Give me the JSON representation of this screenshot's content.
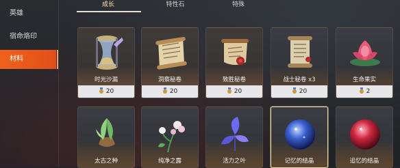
{
  "sidebar": {
    "items": [
      {
        "label": "英雄"
      },
      {
        "label": "宿命烙印"
      },
      {
        "label": "材料",
        "active": true
      }
    ]
  },
  "tabs": [
    {
      "label": "成长",
      "active": true
    },
    {
      "label": "特性石"
    },
    {
      "label": "特殊"
    }
  ],
  "items": [
    {
      "name": "时光沙漏",
      "count": "20",
      "icon": "hourglass-icon"
    },
    {
      "name": "洞察秘卷",
      "count": "20",
      "icon": "scroll-icon"
    },
    {
      "name": "致胜秘卷",
      "count": "20",
      "icon": "sealed-scroll-icon"
    },
    {
      "name": "战士秘卷 x3",
      "count": "20",
      "icon": "scroll-icon"
    },
    {
      "name": "生命果实",
      "count": "2",
      "icon": "lotus-fruit-icon"
    },
    {
      "name": "太古之种",
      "icon": "seed-icon"
    },
    {
      "name": "纯净之露",
      "icon": "flower-icon"
    },
    {
      "name": "活力之叶",
      "icon": "leaf-icon"
    },
    {
      "name": "记忆的结晶",
      "icon": "blue-orb-icon",
      "selected": true
    },
    {
      "name": "追忆的结晶",
      "icon": "red-orb-icon"
    }
  ],
  "colors": {
    "accent": "#f0611c",
    "selected_border": "#e8d9a6",
    "tab_active": "#ffe3b0"
  }
}
